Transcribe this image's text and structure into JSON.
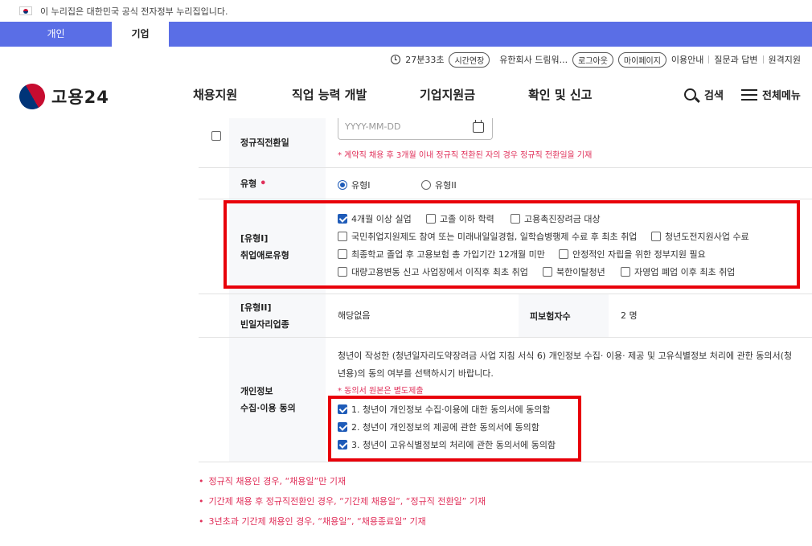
{
  "gov_notice": "이 누리집은 대한민국 공식 전자정부 누리집입니다.",
  "user_tabs": [
    "개인",
    "기업"
  ],
  "util": {
    "timer": "27분33초",
    "extend": "시간연장",
    "company": "유한회사 드림워...",
    "logout": "로그아웃",
    "mypage": "마이페이지",
    "links": [
      "이용안내",
      "질문과 답변",
      "원격지원"
    ]
  },
  "logo_text": "고용24",
  "nav": [
    "채용지원",
    "직업 능력 개발",
    "기업지원금",
    "확인 및 신고"
  ],
  "search_label": "검색",
  "menu_label": "전체메뉴",
  "form": {
    "regular_date_label": "정규직전환일",
    "date_placeholder": "YYYY-MM-DD",
    "regular_date_note": "* 계약직 채용 후 3개월 이내 정규직 전환된 자의 경우 정규직 전환일을 기재",
    "type_label": "유형",
    "type_options": [
      "유형I",
      "유형II"
    ],
    "type1_label_line1": "[유형I]",
    "type1_label_line2": "취업애로유형",
    "type1_options": [
      {
        "label": "4개월 이상 실업",
        "checked": true
      },
      {
        "label": "고졸 이하 학력",
        "checked": false
      },
      {
        "label": "고용촉진장려금 대상",
        "checked": false
      },
      {
        "label": "국민취업지원제도 참여 또는 미래내일일경험, 일학습병행제 수료 후 최초 취업",
        "checked": false
      },
      {
        "label": "청년도전지원사업 수료",
        "checked": false
      },
      {
        "label": "최종학교 졸업 후 고용보험 총 가입기간 12개월 미만",
        "checked": false
      },
      {
        "label": "안정적인 자립을 위한 정부지원 필요",
        "checked": false
      },
      {
        "label": "대량고용변동 신고 사업장에서 이직후 최초 취업",
        "checked": false
      },
      {
        "label": "북한이탈청년",
        "checked": false
      },
      {
        "label": "자영업 폐업 이후 최초 취업",
        "checked": false
      }
    ],
    "type2_label_line1": "[유형II]",
    "type2_label_line2": "빈일자리업종",
    "type2_value": "해당없음",
    "insured_label": "피보험자수",
    "insured_value": "2 명",
    "consent_label_line1": "개인정보",
    "consent_label_line2": "수집·이용 동의",
    "consent_text_line1": "청년이 작성한 (청년일자리도약장려금 사업 지침 서식 6) 개인정보 수집· 이용· 제공 및 고유식별정보 처리에 관한 동의서(청",
    "consent_text_line2": "년용)의 동의 여부를 선택하시기 바랍니다.",
    "consent_note": "* 동의서 원본은 별도제출",
    "consents": [
      {
        "label": "1. 청년이 개인정보 수집·이용에 대한 동의서에 동의함",
        "checked": true
      },
      {
        "label": "2. 청년이 개인정보의 제공에 관한 동의서에 동의함",
        "checked": true
      },
      {
        "label": "3. 청년이 고유식별정보의 처리에 관한 동의서에 동의함",
        "checked": true
      }
    ]
  },
  "notes": [
    "정규직 채용인 경우, “채용일”만 기재",
    "기간제 채용 후 정규직전환인 경우, “기간제 채용일”, “정규직 전환일” 기재",
    "3년초과 기간제 채용인 경우, “채용일”, “채용종료일” 기재"
  ],
  "colors": {
    "tab_bar": "#5a6ee6",
    "highlight": "#e8000a",
    "note_red": "#e0305a",
    "check_blue": "#1e5bb8"
  }
}
